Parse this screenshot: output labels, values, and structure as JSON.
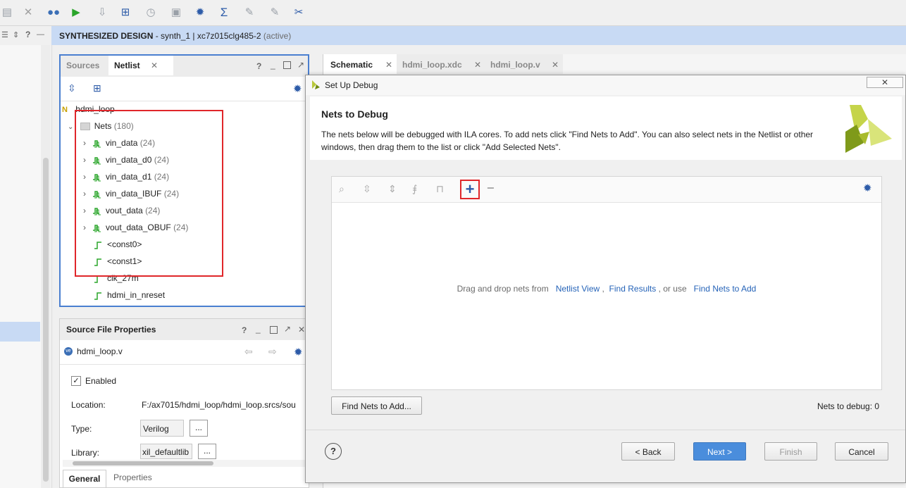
{
  "design_bar": {
    "title": "SYNTHESIZED DESIGN",
    "detail": " - synth_1 | xc7z015clg485-2 ",
    "status": "(active)"
  },
  "left_icons": {
    "help": "?"
  },
  "netlist_panel": {
    "tabs": [
      {
        "label": "Sources"
      },
      {
        "label": "Netlist"
      }
    ],
    "help": "?",
    "top": "hdmi_loop",
    "nets_label": "Nets",
    "nets_count": "(180)",
    "nets": [
      {
        "name": "vin_data",
        "count": "(24)"
      },
      {
        "name": "vin_data_d0",
        "count": "(24)"
      },
      {
        "name": "vin_data_d1",
        "count": "(24)"
      },
      {
        "name": "vin_data_IBUF",
        "count": "(24)"
      },
      {
        "name": "vout_data",
        "count": "(24)"
      },
      {
        "name": "vout_data_OBUF",
        "count": "(24)"
      }
    ],
    "single_nets": [
      {
        "name": "<const0>"
      },
      {
        "name": "<const1>"
      },
      {
        "name": "clk_27m"
      },
      {
        "name": "hdmi_in_nreset"
      }
    ]
  },
  "props_panel": {
    "title": "Source File Properties",
    "help": "?",
    "file": "hdmi_loop.v",
    "enabled_label": "Enabled",
    "location_label": "Location:",
    "location_value": "F:/ax7015/hdmi_loop/hdmi_loop.srcs/sou",
    "type_label": "Type:",
    "type_value": "Verilog",
    "library_label": "Library:",
    "library_value": "xil_defaultlib",
    "ellipsis": "...",
    "bottom_tabs": [
      {
        "label": "General"
      },
      {
        "label": "Properties"
      }
    ]
  },
  "editor_tabs": [
    {
      "label": "Schematic"
    },
    {
      "label": "hdmi_loop.xdc"
    },
    {
      "label": "hdmi_loop.v"
    }
  ],
  "dialog": {
    "title": "Set Up Debug",
    "heading": "Nets to Debug",
    "description": "The nets below will be debugged with ILA cores. To add nets click \"Find Nets to Add\". You can also select nets in the Netlist or other windows, then drag them to the list or click \"Add Selected Nets\".",
    "drop_hint_prefix": "Drag and drop nets from",
    "drop_link_1": "Netlist View",
    "drop_sep": ",",
    "drop_link_2": "Find Results",
    "drop_mid": ", or use",
    "drop_link_3": "Find Nets to Add",
    "find_button": "Find Nets to Add...",
    "nets_to_debug": "Nets to debug: 0",
    "help": "?",
    "back": "< Back",
    "next": "Next >",
    "finish": "Finish",
    "cancel": "Cancel"
  },
  "colors": {
    "accent_blue": "#4a8ddc",
    "highlight_red": "#e0262a",
    "panel_border_blue": "#4a7fd0",
    "design_bar": "#c8daf4"
  }
}
